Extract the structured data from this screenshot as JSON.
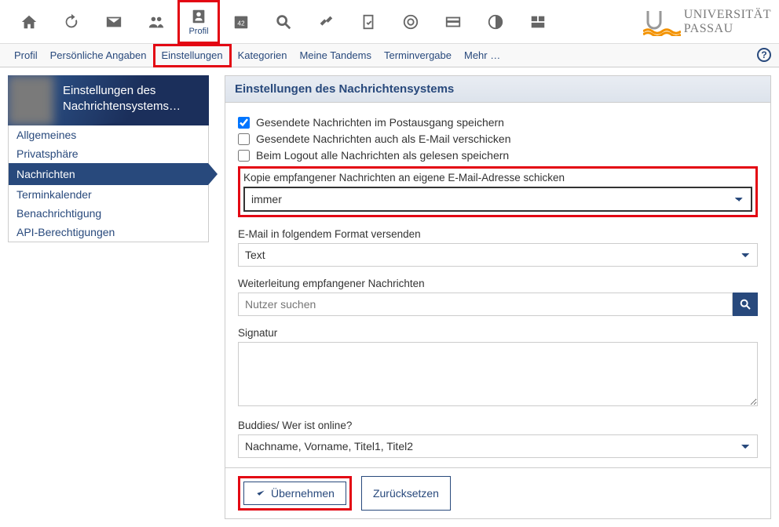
{
  "topnav": {
    "profile_label": "Profil"
  },
  "logo": {
    "name": "UNIVERSITÄT PASSAU"
  },
  "subnav": [
    "Profil",
    "Persönliche Angaben",
    "Einstellungen",
    "Kategorien",
    "Meine Tandems",
    "Terminvergabe",
    "Mehr …"
  ],
  "page_title": "Einstellungen des Nachrichtensystems…",
  "sidenav": [
    "Allgemeines",
    "Privatsphäre",
    "Nachrichten",
    "Terminkalender",
    "Benachrichtigung",
    "API-Berechtigungen"
  ],
  "active_sidenav": "Nachrichten",
  "panel": {
    "title": "Einstellungen des Nachrichtensystems",
    "chk1": "Gesendete Nachrichten im Postausgang speichern",
    "chk2": "Gesendete Nachrichten auch als E-Mail verschicken",
    "chk3": "Beim Logout alle Nachrichten als gelesen speichern",
    "copy_label": "Kopie empfangener Nachrichten an eigene E-Mail-Adresse schicken",
    "copy_value": "immer",
    "format_label": "E-Mail in folgendem Format versenden",
    "format_value": "Text",
    "forward_label": "Weiterleitung empfangener Nachrichten",
    "forward_placeholder": "Nutzer suchen",
    "signature_label": "Signatur",
    "buddies_label": "Buddies/ Wer ist online?",
    "buddies_value": "Nachname, Vorname, Titel1, Titel2"
  },
  "buttons": {
    "submit": "Übernehmen",
    "reset": "Zurücksetzen"
  }
}
